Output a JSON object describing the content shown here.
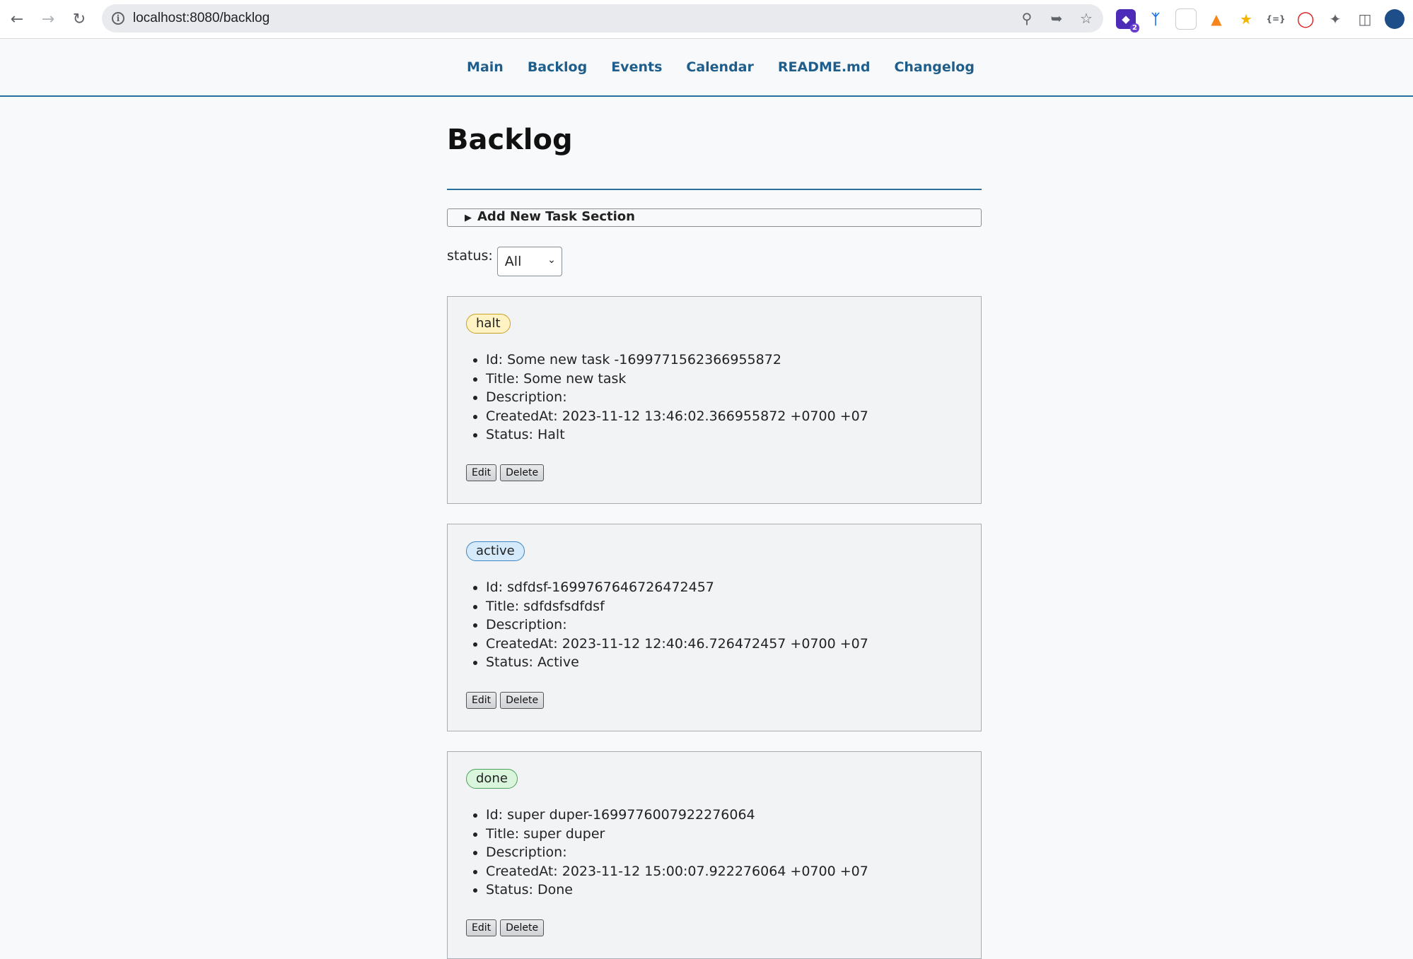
{
  "browser": {
    "url": "localhost:8080/backlog",
    "extensions": [
      {
        "icon": "extension-stack-icon",
        "color": "#4b2bb8",
        "badge": "2"
      },
      {
        "icon": "extension-y-icon",
        "color": "#1a73e8"
      },
      {
        "icon": "extension-blank-icon",
        "color": "#e8eaed"
      },
      {
        "icon": "metamask-fox-icon",
        "color": "#f6851b"
      },
      {
        "icon": "extension-lock-icon",
        "color": "#f4b400"
      },
      {
        "icon": "json-braces-icon",
        "color": "#5f6368"
      },
      {
        "icon": "opera-icon",
        "color": "#e01a1a"
      },
      {
        "icon": "puzzle-icon",
        "color": "#5f6368"
      },
      {
        "icon": "side-panel-icon",
        "color": "#5f6368"
      },
      {
        "icon": "profile-avatar-icon",
        "color": "#1d4e89"
      }
    ]
  },
  "nav": {
    "items": [
      {
        "label": "Main"
      },
      {
        "label": "Backlog"
      },
      {
        "label": "Events"
      },
      {
        "label": "Calendar"
      },
      {
        "label": "README.md"
      },
      {
        "label": "Changelog"
      }
    ]
  },
  "page": {
    "title": "Backlog",
    "add_section_label": "Add New Task Section",
    "filter_label": "status:",
    "filter_value": "All"
  },
  "tasks": [
    {
      "badge": "halt",
      "id": "Id: Some new task -1699771562366955872",
      "title": "Title: Some new task",
      "description": "Description:",
      "created": "CreatedAt: 2023-11-12 13:46:02.366955872 +0700 +07",
      "status": "Status: Halt",
      "edit": "Edit",
      "delete": "Delete"
    },
    {
      "badge": "active",
      "id": "Id: sdfdsf-1699767646726472457",
      "title": "Title: sdfdsfsdfdsf",
      "description": "Description:",
      "created": "CreatedAt: 2023-11-12 12:40:46.726472457 +0700 +07",
      "status": "Status: Active",
      "edit": "Edit",
      "delete": "Delete"
    },
    {
      "badge": "done",
      "id": "Id: super duper-1699776007922276064",
      "title": "Title: super duper",
      "description": "Description:",
      "created": "CreatedAt: 2023-11-12 15:00:07.922276064 +0700 +07",
      "status": "Status: Done",
      "edit": "Edit",
      "delete": "Delete"
    }
  ]
}
